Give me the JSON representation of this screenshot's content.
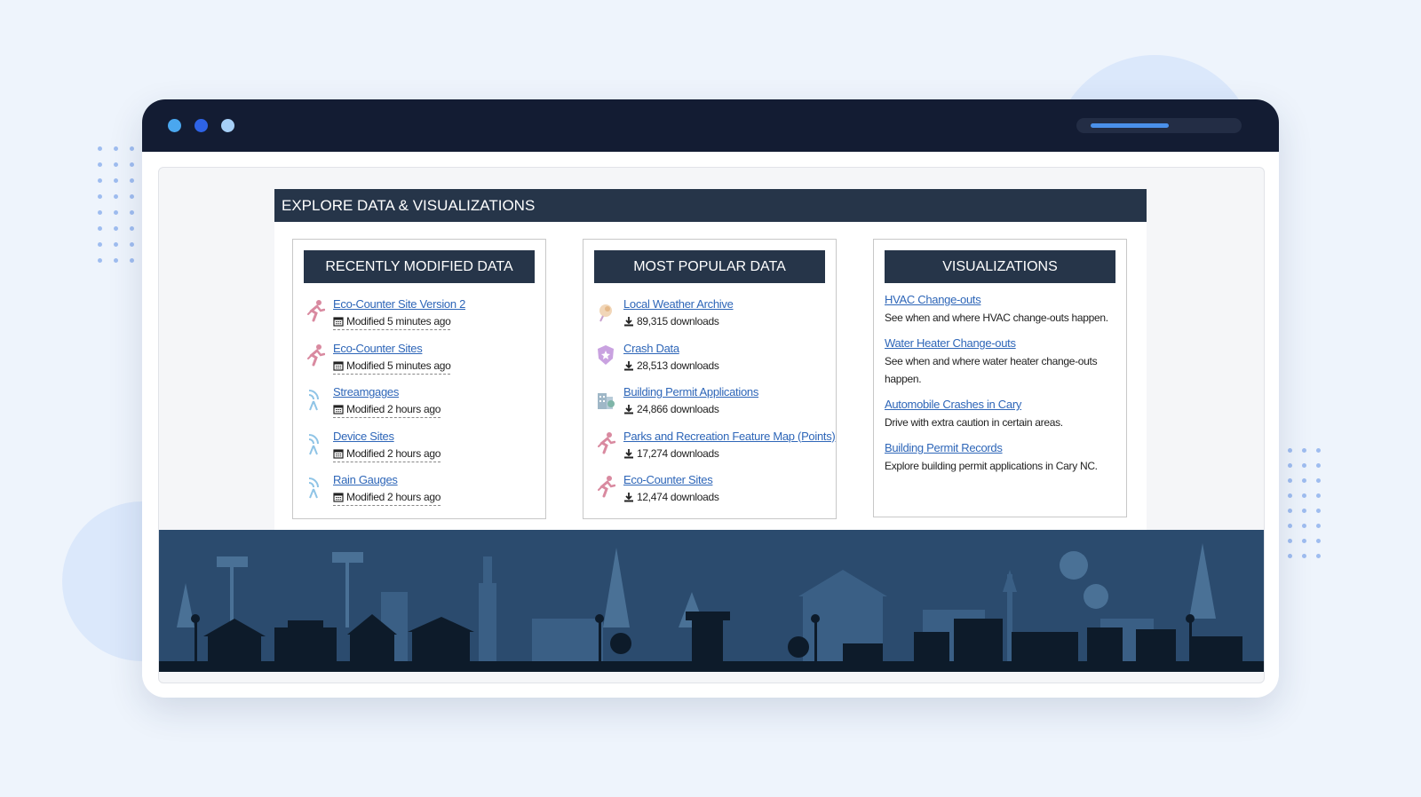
{
  "section": {
    "title": "EXPLORE DATA & VISUALIZATIONS"
  },
  "recent": {
    "title": "RECENTLY MODIFIED DATA",
    "items": [
      {
        "label": "Eco-Counter Site Version 2",
        "meta": "Modified 5 minutes ago",
        "icon": "cyclist-icon"
      },
      {
        "label": "Eco-Counter Sites",
        "meta": "Modified 5 minutes ago",
        "icon": "cyclist-icon"
      },
      {
        "label": "Streamgages",
        "meta": "Modified 2 hours ago",
        "icon": "signal-icon"
      },
      {
        "label": "Device Sites",
        "meta": "Modified 2 hours ago",
        "icon": "signal-icon"
      },
      {
        "label": "Rain Gauges",
        "meta": "Modified 2 hours ago",
        "icon": "signal-icon"
      }
    ]
  },
  "popular": {
    "title": "MOST POPULAR DATA",
    "items": [
      {
        "label": "Local Weather Archive",
        "meta": "89,315 downloads",
        "icon": "weather-icon"
      },
      {
        "label": "Crash Data",
        "meta": "28,513 downloads",
        "icon": "badge-icon"
      },
      {
        "label": "Building Permit Applications",
        "meta": "24,866 downloads",
        "icon": "building-icon"
      },
      {
        "label": "Parks and Recreation Feature Map (Points)",
        "meta": "17,274 downloads",
        "icon": "cyclist-icon"
      },
      {
        "label": "Eco-Counter Sites",
        "meta": "12,474 downloads",
        "icon": "cyclist-icon"
      }
    ]
  },
  "visualizations": {
    "title": "VISUALIZATIONS",
    "items": [
      {
        "label": "HVAC Change-outs",
        "desc": "See when and where HVAC change-outs happen."
      },
      {
        "label": "Water Heater Change-outs",
        "desc": "See when and where water heater change-outs happen."
      },
      {
        "label": "Automobile Crashes in Cary",
        "desc": "Drive with extra caution in certain areas."
      },
      {
        "label": "Building Permit Records",
        "desc": "Explore building permit applications in Cary NC."
      }
    ]
  },
  "colors": {
    "page_bg": "#eef4fc",
    "titlebar": "#131c33",
    "header_bg": "#263549",
    "link": "#2e66b8",
    "skyline_bg": "#2b4b6e",
    "skyline_fg": "#0d1b2a"
  }
}
